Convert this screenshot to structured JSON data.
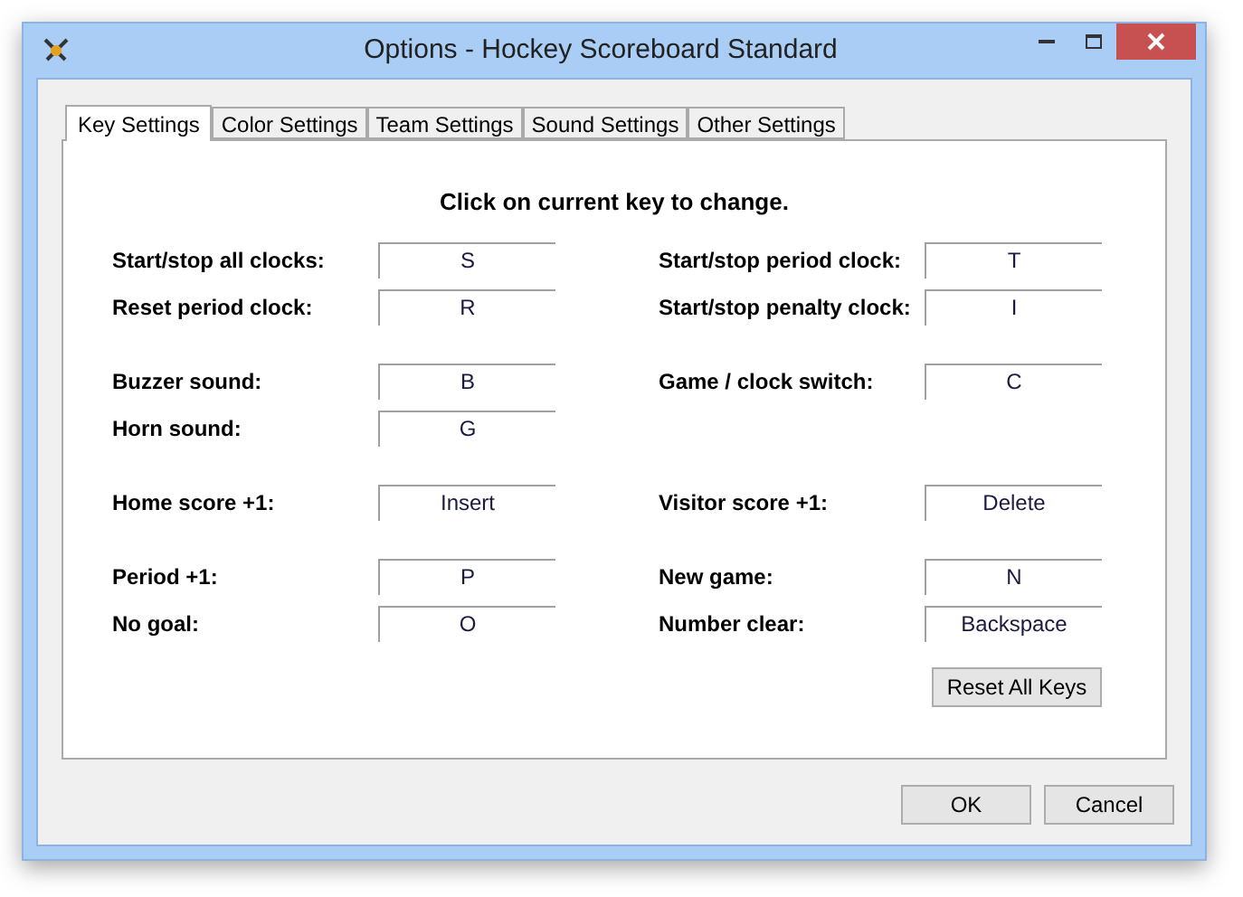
{
  "window": {
    "title": "Options - Hockey Scoreboard Standard"
  },
  "tabs": [
    {
      "label": "Key Settings",
      "selected": true
    },
    {
      "label": "Color Settings",
      "selected": false
    },
    {
      "label": "Team Settings",
      "selected": false
    },
    {
      "label": "Sound Settings",
      "selected": false
    },
    {
      "label": "Other Settings",
      "selected": false
    }
  ],
  "instruction": "Click on current key to change.",
  "groups": [
    {
      "rows": [
        {
          "left": {
            "label": "Start/stop all clocks:",
            "key": "S"
          },
          "right": {
            "label": "Start/stop period clock:",
            "key": "T"
          }
        },
        {
          "left": {
            "label": "Reset period clock:",
            "key": "R"
          },
          "right": {
            "label": "Start/stop penalty clock:",
            "key": "I"
          }
        }
      ]
    },
    {
      "rows": [
        {
          "left": {
            "label": "Buzzer sound:",
            "key": "B"
          },
          "right": {
            "label": "Game / clock switch:",
            "key": "C"
          }
        },
        {
          "left": {
            "label": "Horn sound:",
            "key": "G"
          }
        }
      ]
    },
    {
      "rows": [
        {
          "left": {
            "label": "Home score +1:",
            "key": "Insert"
          },
          "right": {
            "label": "Visitor score +1:",
            "key": "Delete"
          }
        }
      ]
    },
    {
      "rows": [
        {
          "left": {
            "label": "Period +1:",
            "key": "P"
          },
          "right": {
            "label": "New game:",
            "key": "N"
          }
        },
        {
          "left": {
            "label": "No goal:",
            "key": "O"
          },
          "right": {
            "label": "Number clear:",
            "key": "Backspace"
          }
        }
      ]
    }
  ],
  "reset_button": "Reset All Keys",
  "buttons": [
    "OK",
    "Cancel"
  ]
}
